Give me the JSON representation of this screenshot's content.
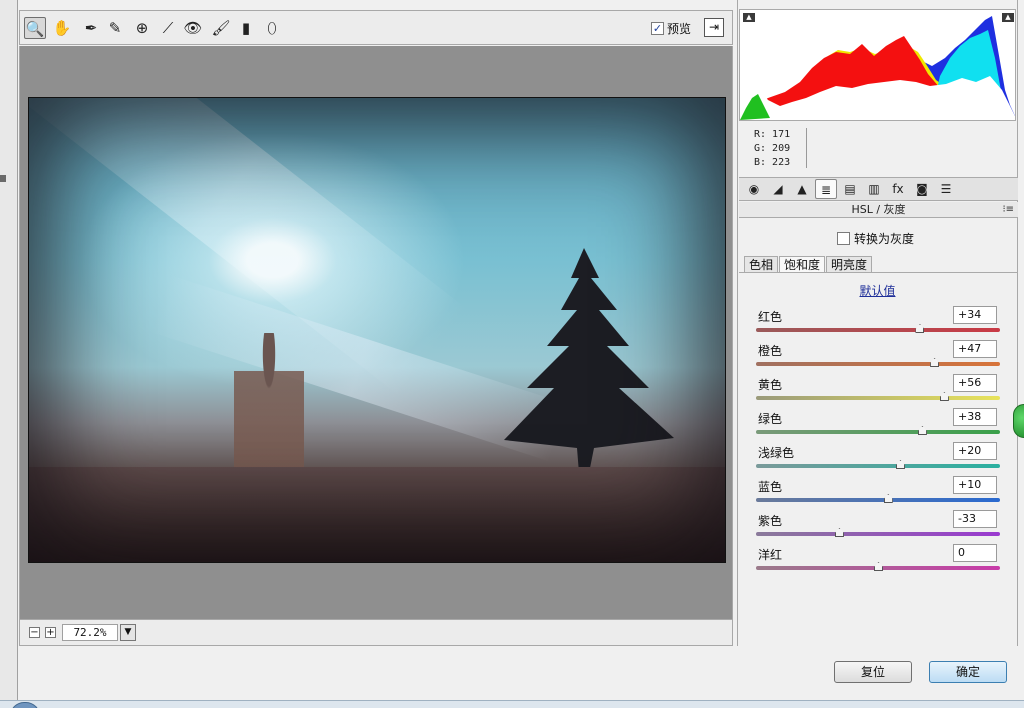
{
  "toolbar": {
    "tools": [
      {
        "name": "zoom-tool-icon",
        "glyph": "🔍"
      },
      {
        "name": "hand-tool-icon",
        "glyph": "✋"
      },
      {
        "name": "white-balance-icon",
        "glyph": "✒"
      },
      {
        "name": "color-sampler-icon",
        "glyph": "✎"
      },
      {
        "name": "targeted-adjust-icon",
        "glyph": "⊕"
      },
      {
        "name": "straighten-icon",
        "glyph": "⟋"
      },
      {
        "name": "red-eye-icon",
        "glyph": "👁"
      },
      {
        "name": "brush-icon",
        "glyph": "🖌"
      },
      {
        "name": "graduated-filter-icon",
        "glyph": "▮"
      },
      {
        "name": "radial-filter-icon",
        "glyph": "⬯"
      }
    ],
    "preview_label": "预览",
    "preview_checked": "✓"
  },
  "zoom": {
    "minus": "−",
    "plus": "+",
    "value": "72.2%",
    "dropdown": "▼"
  },
  "histogram": {
    "readout": {
      "r": "R:  171",
      "g": "G:  209",
      "b": "B:  223"
    }
  },
  "panel_tabs": [
    {
      "name": "tab-basic",
      "glyph": "◉"
    },
    {
      "name": "tab-tone-curve",
      "glyph": "◢"
    },
    {
      "name": "tab-detail",
      "glyph": "▲"
    },
    {
      "name": "tab-hsl",
      "glyph": "≣"
    },
    {
      "name": "tab-split-toning",
      "glyph": "▤"
    },
    {
      "name": "tab-lens",
      "glyph": "▥"
    },
    {
      "name": "tab-effects",
      "glyph": "fx"
    },
    {
      "name": "tab-camera-calibration",
      "glyph": "◙"
    },
    {
      "name": "tab-presets",
      "glyph": "☰"
    }
  ],
  "section": {
    "title": "HSL / 灰度",
    "menu": "⁝≡",
    "grayscale_label": "转换为灰度",
    "subtabs": [
      "色相",
      "饱和度",
      "明亮度"
    ],
    "default_link": "默认值"
  },
  "sliders": [
    {
      "label": "红色",
      "value": "+34",
      "pos": 0.67,
      "c1": "#9a5a5a",
      "c2": "#c93a45"
    },
    {
      "label": "橙色",
      "value": "+47",
      "pos": 0.73,
      "c1": "#a07060",
      "c2": "#d8743a"
    },
    {
      "label": "黄色",
      "value": "+56",
      "pos": 0.77,
      "c1": "#9a9a7a",
      "c2": "#e8e35a"
    },
    {
      "label": "绿色",
      "value": "+38",
      "pos": 0.68,
      "c1": "#7a9a7a",
      "c2": "#3aa04a"
    },
    {
      "label": "浅绿色",
      "value": "+20",
      "pos": 0.59,
      "c1": "#7a9a9a",
      "c2": "#2ab0a0"
    },
    {
      "label": "蓝色",
      "value": "+10",
      "pos": 0.54,
      "c1": "#6a7a9a",
      "c2": "#2a6ad0"
    },
    {
      "label": "紫色",
      "value": "-33",
      "pos": 0.34,
      "c1": "#8a7a9a",
      "c2": "#9a3ad0"
    },
    {
      "label": "洋红",
      "value": "0",
      "pos": 0.5,
      "c1": "#9a7a8a",
      "c2": "#c83aa8"
    }
  ],
  "buttons": {
    "reset": "复位",
    "ok": "确定"
  }
}
